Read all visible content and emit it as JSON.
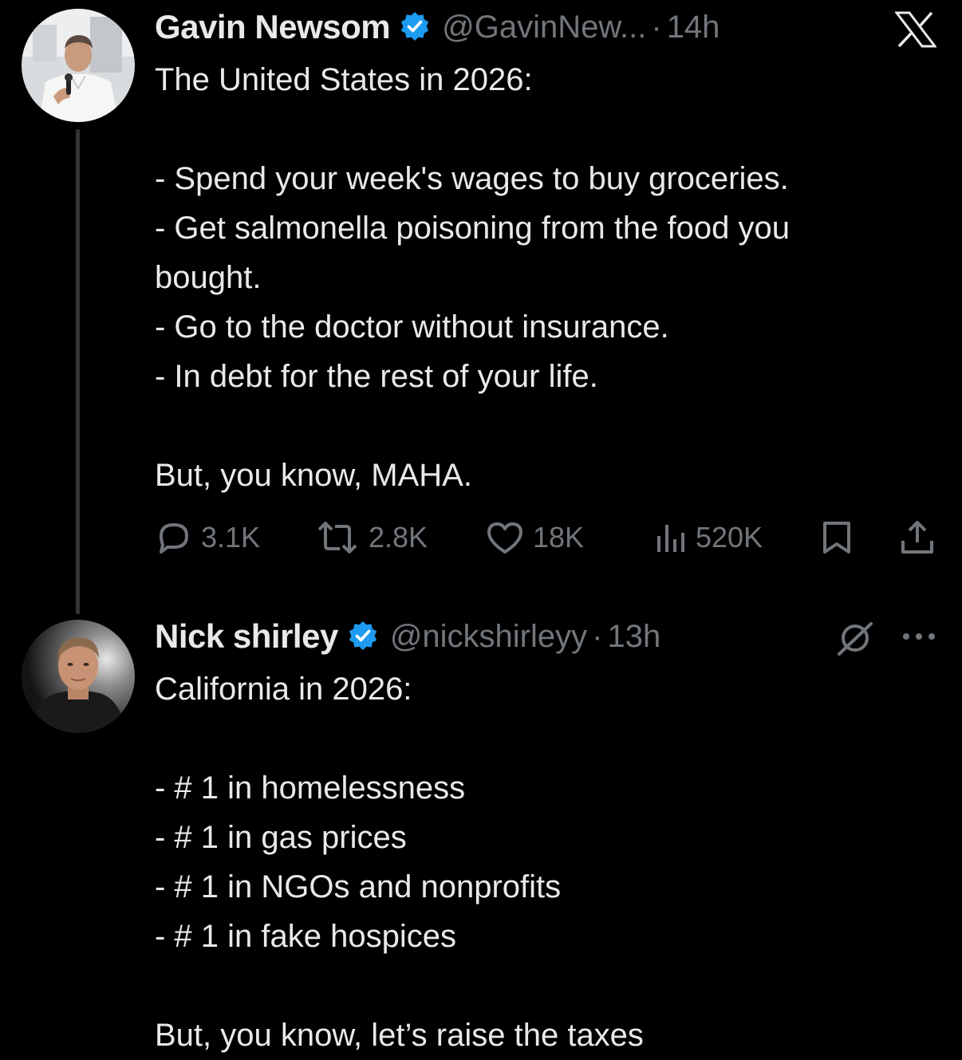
{
  "app": {
    "x_logo_icon": "x-logo-icon",
    "grok_icon": "grok-icon",
    "more_icon": "more-options-icon",
    "accent_color": "#1d9bf0",
    "text_color": "#e7e9ea",
    "muted_color": "#71767b",
    "background": "#000000"
  },
  "tweets": [
    {
      "author_name": "Gavin Newsom",
      "verified": true,
      "handle": "@GavinNew...",
      "separator": "·",
      "time": "14h",
      "lines": [
        "The United States in 2026:",
        "",
        "- Spend your week's wages to buy groceries.",
        "- Get salmonella poisoning from the food you",
        "bought.",
        "- Go to the doctor without insurance.",
        "- In debt for the rest of your life.",
        "",
        "But, you know, MAHA."
      ],
      "stats": {
        "replies": "3.1K",
        "reposts": "2.8K",
        "likes": "18K",
        "views": "520K"
      }
    },
    {
      "author_name": "Nick shirley",
      "verified": true,
      "handle": "@nickshirleyy",
      "separator": "·",
      "time": "13h",
      "lines": [
        "California in 2026:",
        "",
        "- # 1 in homelessness",
        "- # 1 in gas prices",
        "- # 1 in NGOs and nonprofits",
        "- # 1 in fake hospices",
        "",
        "But, you know, let’s raise the taxes"
      ]
    }
  ]
}
